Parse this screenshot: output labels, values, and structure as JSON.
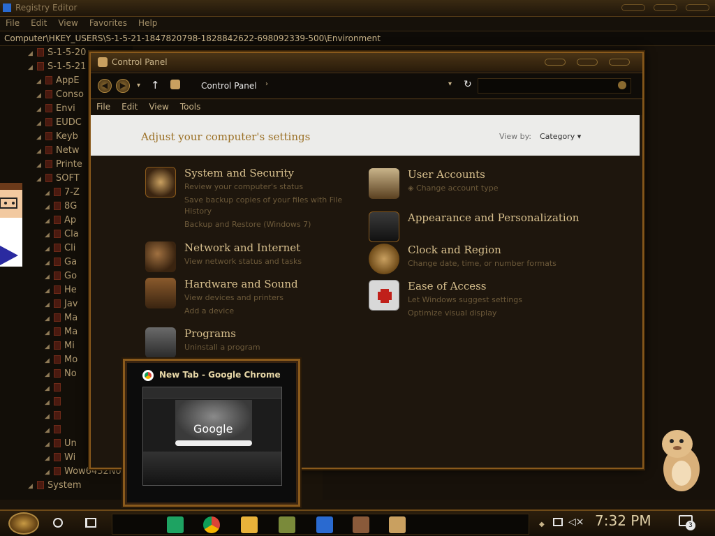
{
  "registry_editor": {
    "title": "Registry Editor",
    "menu": [
      "File",
      "Edit",
      "View",
      "Favorites",
      "Help"
    ],
    "address": "Computer\\HKEY_USERS\\S-1-5-21-1847820798-1828842622-698092339-500\\Environment",
    "tree": [
      {
        "label": "S-1-5-20"
      },
      {
        "label": "S-1-5-21"
      },
      {
        "label": "AppE"
      },
      {
        "label": "Conso"
      },
      {
        "label": "Envi"
      },
      {
        "label": "EUDC"
      },
      {
        "label": "Keyb"
      },
      {
        "label": "Netw"
      },
      {
        "label": "Printe"
      },
      {
        "label": "SOFT"
      },
      {
        "label": "7-Z"
      },
      {
        "label": "8G"
      },
      {
        "label": "Ap"
      },
      {
        "label": "Cla"
      },
      {
        "label": "Cli"
      },
      {
        "label": "Ga"
      },
      {
        "label": "Go"
      },
      {
        "label": "He"
      },
      {
        "label": "Jav"
      },
      {
        "label": "Ma"
      },
      {
        "label": "Ma"
      },
      {
        "label": "Mi"
      },
      {
        "label": "Mo"
      },
      {
        "label": "No"
      },
      {
        "label": ""
      },
      {
        "label": ""
      },
      {
        "label": ""
      },
      {
        "label": ""
      },
      {
        "label": "Un"
      },
      {
        "label": "Wi"
      },
      {
        "label": "Wow6432No"
      },
      {
        "label": "System"
      }
    ]
  },
  "control_panel": {
    "title": "Control Panel",
    "breadcrumb": "Control Panel",
    "menu": [
      "File",
      "Edit",
      "View",
      "Tools"
    ],
    "heading": "Adjust your computer's settings",
    "view_by_label": "View by:",
    "view_by_value": "Category",
    "categories": [
      {
        "title": "System and Security",
        "links": [
          "Review your computer's status",
          "Save backup copies of your files with File",
          "History",
          "Backup and Restore (Windows 7)"
        ]
      },
      {
        "title": "Network and Internet",
        "links": [
          "View network status and tasks"
        ]
      },
      {
        "title": "Hardware and Sound",
        "links": [
          "View devices and printers",
          "Add a device"
        ]
      },
      {
        "title": "Programs",
        "links": [
          "Uninstall a program"
        ]
      },
      {
        "title": "User Accounts",
        "links": [
          "Change account type"
        ]
      },
      {
        "title": "Appearance and Personalization",
        "links": []
      },
      {
        "title": "Clock and Region",
        "links": [
          "Change date, time, or number formats"
        ]
      },
      {
        "title": "Ease of Access",
        "links": [
          "Let Windows suggest settings",
          "Optimize visual display"
        ]
      }
    ]
  },
  "chrome_thumbnail": {
    "title": "New Tab - Google Chrome",
    "logo_text": "Google"
  },
  "taskbar": {
    "clock": "7:32 PM",
    "notification_count": "3",
    "apps": [
      "sheets-icon",
      "chrome-icon",
      "file-explorer-icon",
      "game-icon",
      "puzzle-icon",
      "gears-icon",
      "control-panel-icon"
    ]
  },
  "colors": {
    "accent": "#8a5a1c",
    "title_text": "#d8c08e",
    "heading_text": "#9a6f24"
  }
}
